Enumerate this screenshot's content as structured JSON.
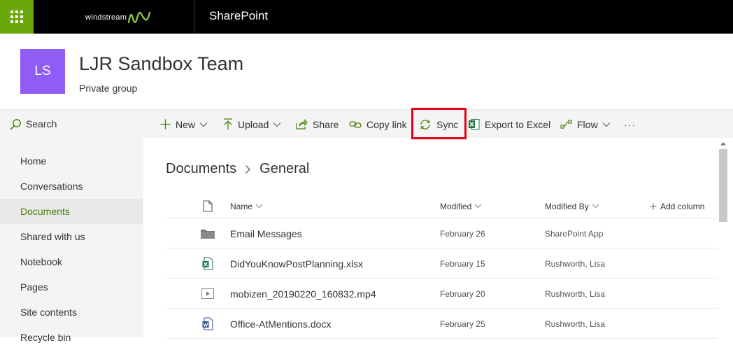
{
  "suite": {
    "brand": "windstream",
    "app_name": "SharePoint",
    "brand_color": "#6aa80a"
  },
  "site": {
    "logo_initials": "LS",
    "logo_color": "#8f5cf7",
    "title": "LJR Sandbox Team",
    "subtitle": "Private group"
  },
  "search": {
    "label": "Search",
    "icon": "search-icon"
  },
  "nav": {
    "items": [
      {
        "label": "Home",
        "active": false
      },
      {
        "label": "Conversations",
        "active": false
      },
      {
        "label": "Documents",
        "active": true
      },
      {
        "label": "Shared with us",
        "active": false
      },
      {
        "label": "Notebook",
        "active": false
      },
      {
        "label": "Pages",
        "active": false
      },
      {
        "label": "Site contents",
        "active": false
      },
      {
        "label": "Recycle bin",
        "active": false
      }
    ]
  },
  "commands": {
    "new": "New",
    "upload": "Upload",
    "share": "Share",
    "copy_link": "Copy link",
    "sync": "Sync",
    "export": "Export to Excel",
    "flow": "Flow",
    "more": "···"
  },
  "breadcrumb": {
    "root": "Documents",
    "current": "General"
  },
  "table": {
    "columns": {
      "name": "Name",
      "modified": "Modified",
      "modified_by": "Modified By",
      "add_column": "Add column"
    },
    "rows": [
      {
        "icon": "folder-icon",
        "name": "Email Messages",
        "modified": "February 26",
        "modified_by": "SharePoint App"
      },
      {
        "icon": "excel-file-icon",
        "name": "DidYouKnowPostPlanning.xlsx",
        "modified": "February 15",
        "modified_by": "Rushworth, Lisa"
      },
      {
        "icon": "video-file-icon",
        "name": "mobizen_20190220_160832.mp4",
        "modified": "February 20",
        "modified_by": "Rushworth, Lisa"
      },
      {
        "icon": "word-file-icon",
        "name": "Office-AtMentions.docx",
        "modified": "February 25",
        "modified_by": "Rushworth, Lisa"
      }
    ]
  },
  "colors": {
    "accent_green": "#498205",
    "highlight_red": "#e2001a"
  }
}
